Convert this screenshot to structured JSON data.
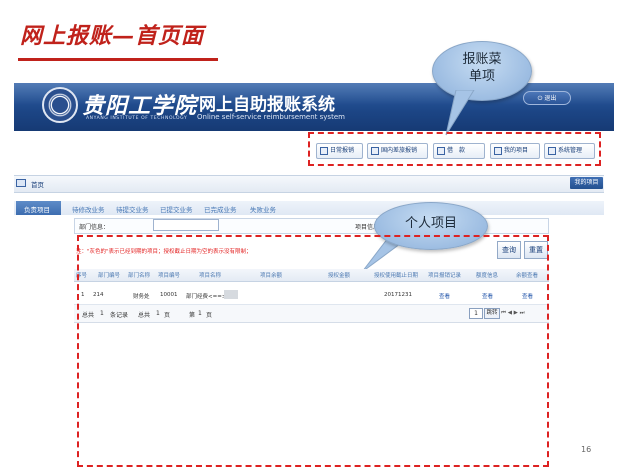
{
  "slide": {
    "title": "网上报账—首页面",
    "page_number": "16"
  },
  "header": {
    "school_name": "贵阳工学院",
    "school_name_en": "ANYANG INSTITUTE OF TECHNOLOGY",
    "system_title": "网上自助报账系统",
    "system_title_en": "Online self-service reimbursement system",
    "logout_label": "退出"
  },
  "callouts": {
    "menu": [
      "报账菜",
      "单项"
    ],
    "personal": "个人项目"
  },
  "menu": {
    "items": [
      {
        "label": "日常报销"
      },
      {
        "label": "国内差旅报销"
      },
      {
        "label": "借　款"
      },
      {
        "label": "我的项目"
      },
      {
        "label": "系统管理"
      }
    ]
  },
  "homebar": {
    "home_label": "首页",
    "my_project": "我的项目"
  },
  "tabs": [
    {
      "label": "负责项目",
      "active": true
    },
    {
      "label": "待修改业务"
    },
    {
      "label": "待提交业务"
    },
    {
      "label": "已提交业务"
    },
    {
      "label": "已完成业务"
    },
    {
      "label": "失败业务"
    }
  ],
  "filter": {
    "dept_label": "部门信息：",
    "proj_label": "项目信息",
    "note": "注：\"灰色的\"表示已经到期的项目；授权截止日期为空的表示没有限制；",
    "search": "查询",
    "reset": "重置"
  },
  "table": {
    "columns": [
      "序号",
      "部门编号",
      "部门名称",
      "项目编号",
      "项目名称",
      "项目余额",
      "授权金额",
      "授权使用截止日期",
      "项目报销记录",
      "额度信息",
      "余额查看"
    ],
    "row": {
      "seq": "1",
      "dept_no": "214",
      "dept_name": "财务处",
      "proj_no": "10001",
      "proj_name": "部门经费<==>",
      "deadline": "20171231",
      "record": "查看",
      "quota": "查看",
      "balance": "查看"
    }
  },
  "footer": {
    "total": "总共",
    "count": "1",
    "records": "条记录",
    "total2": "总共",
    "pages": "1",
    "page_unit": "页",
    "current_prefix": "第",
    "current": "1",
    "current_unit": "页",
    "page_input": "1",
    "jump": "跳转",
    "arrows": "⏮ ◀ ▶ ⏭"
  }
}
